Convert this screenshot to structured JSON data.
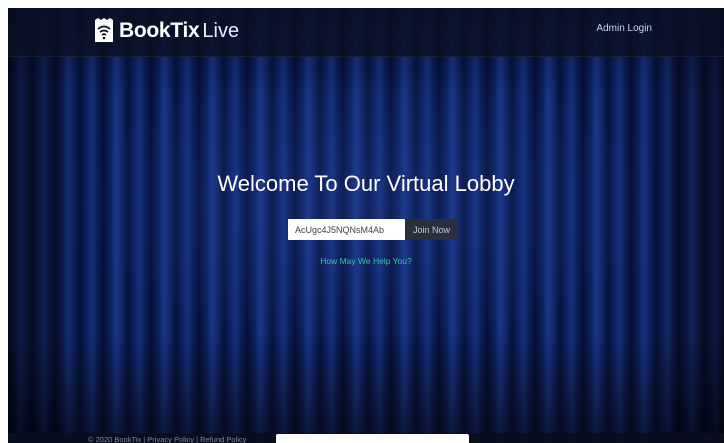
{
  "header": {
    "brand": "BookTix",
    "brand_suffix": "Live",
    "admin_login": "Admin Login"
  },
  "main": {
    "welcome": "Welcome To Our Virtual Lobby",
    "code_value": "AcUgc4J5NQNsM4Ab",
    "join_label": "Join Now",
    "help_link": "How May We Help You?"
  },
  "footer": {
    "text": "© 2020 BookTix | Privacy Policy | Refund Policy"
  },
  "colors": {
    "help_link": "#36c7a6",
    "curtain": "#0c1f5c"
  }
}
